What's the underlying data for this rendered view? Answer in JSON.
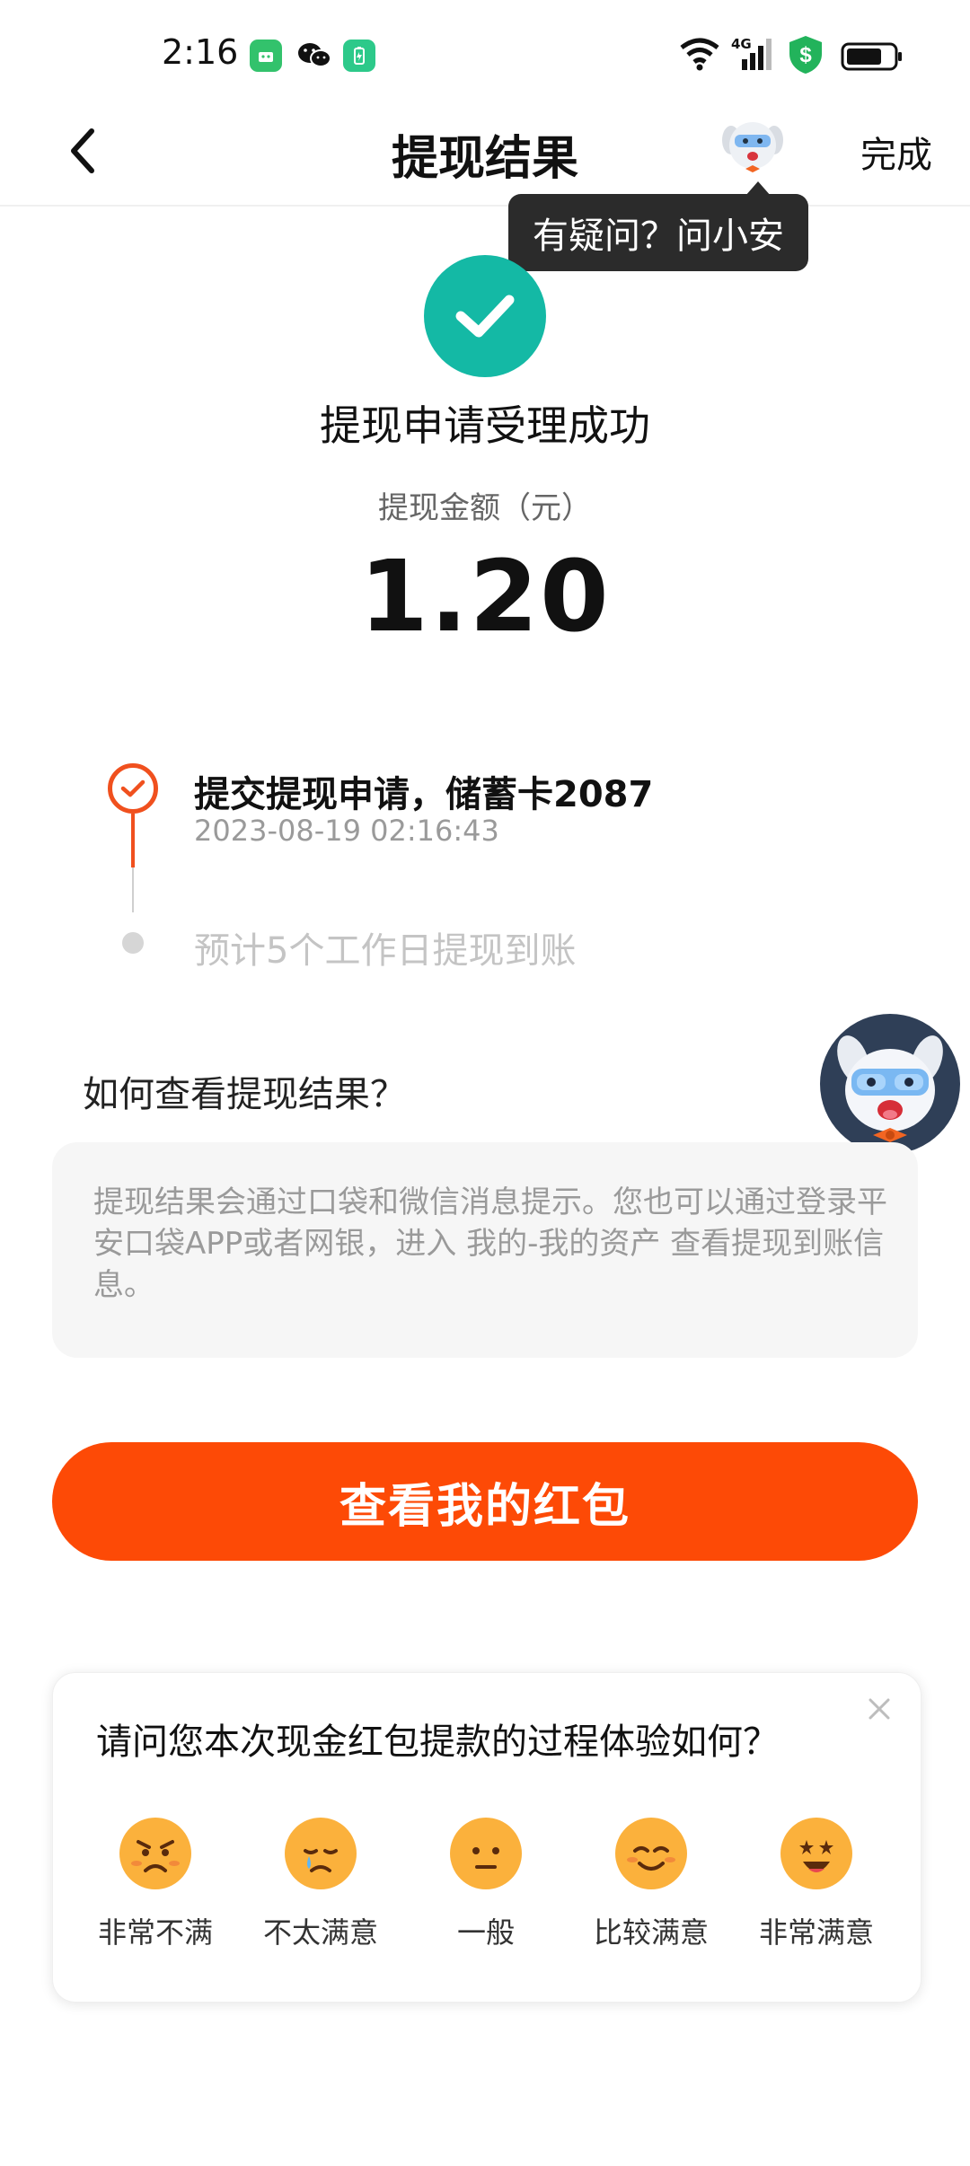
{
  "status_bar": {
    "time": "2:16",
    "network": "4G",
    "icons": [
      "green-app-icon",
      "wechat-icon",
      "green-battery-app-icon",
      "wifi-icon",
      "signal-icon",
      "shield-dollar-icon",
      "battery-icon"
    ]
  },
  "nav": {
    "title": "提现结果",
    "done_label": "完成",
    "back_icon": "chevron-left-icon",
    "mascot_icon": "mascot-icon"
  },
  "tooltip": {
    "text": "有疑问？问小安"
  },
  "result": {
    "title": "提现申请受理成功",
    "amount_label": "提现金额（元）",
    "amount": "1.20"
  },
  "timeline": {
    "steps": [
      {
        "label": "提交提现申请，储蓄卡2087",
        "time": "2023-08-19 02:16:43",
        "status": "done"
      },
      {
        "label": "预计5个工作日提现到账",
        "status": "pending"
      }
    ]
  },
  "help": {
    "title": "如何查看提现结果？",
    "body": "提现结果会通过口袋和微信消息提示。您也可以通过登录平安口袋APP或者网银，进入 我的-我的资产 查看提现到账信息。"
  },
  "cta": {
    "label": "查看我的红包"
  },
  "survey": {
    "title": "请问您本次现金红包提款的过程体验如何？",
    "options": [
      {
        "label": "非常不满",
        "icon": "angry-face-icon"
      },
      {
        "label": "不太满意",
        "icon": "sad-face-icon"
      },
      {
        "label": "一般",
        "icon": "neutral-face-icon"
      },
      {
        "label": "比较满意",
        "icon": "smile-face-icon"
      },
      {
        "label": "非常满意",
        "icon": "star-eyes-face-icon"
      }
    ]
  },
  "colors": {
    "accent": "#fd4a06",
    "success": "#14b9a5",
    "timeline": "#f0501e"
  }
}
